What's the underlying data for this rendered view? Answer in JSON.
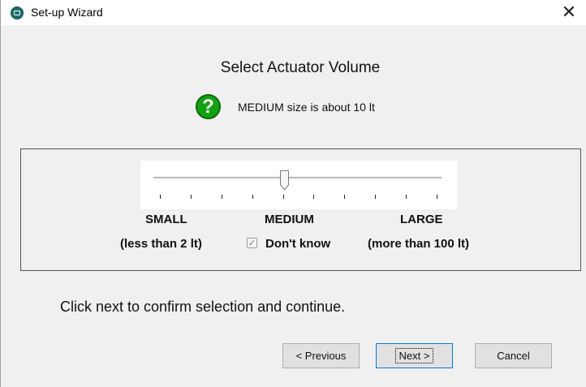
{
  "window": {
    "title": "Set-up Wizard",
    "close_glyph": "✕"
  },
  "page": {
    "heading": "Select Actuator Volume",
    "help_glyph": "?",
    "help_text": "MEDIUM size is about 10 lt"
  },
  "slider": {
    "value_fraction": 0.45,
    "tick_count": 10,
    "labels": {
      "small": "SMALL",
      "medium": "MEDIUM",
      "large": "LARGE"
    },
    "sublabels": {
      "small": "(less than 2 lt)",
      "large": "(more than 100 lt)"
    }
  },
  "dont_know": {
    "label": "Don't know",
    "checked": true,
    "check_glyph": "✓"
  },
  "instruction": "Click next to confirm selection and continue.",
  "buttons": {
    "previous": "< Previous",
    "next": "Next >",
    "cancel": "Cancel"
  },
  "colors": {
    "help_icon": "#11a311",
    "default_button_border": "#0078d7"
  }
}
